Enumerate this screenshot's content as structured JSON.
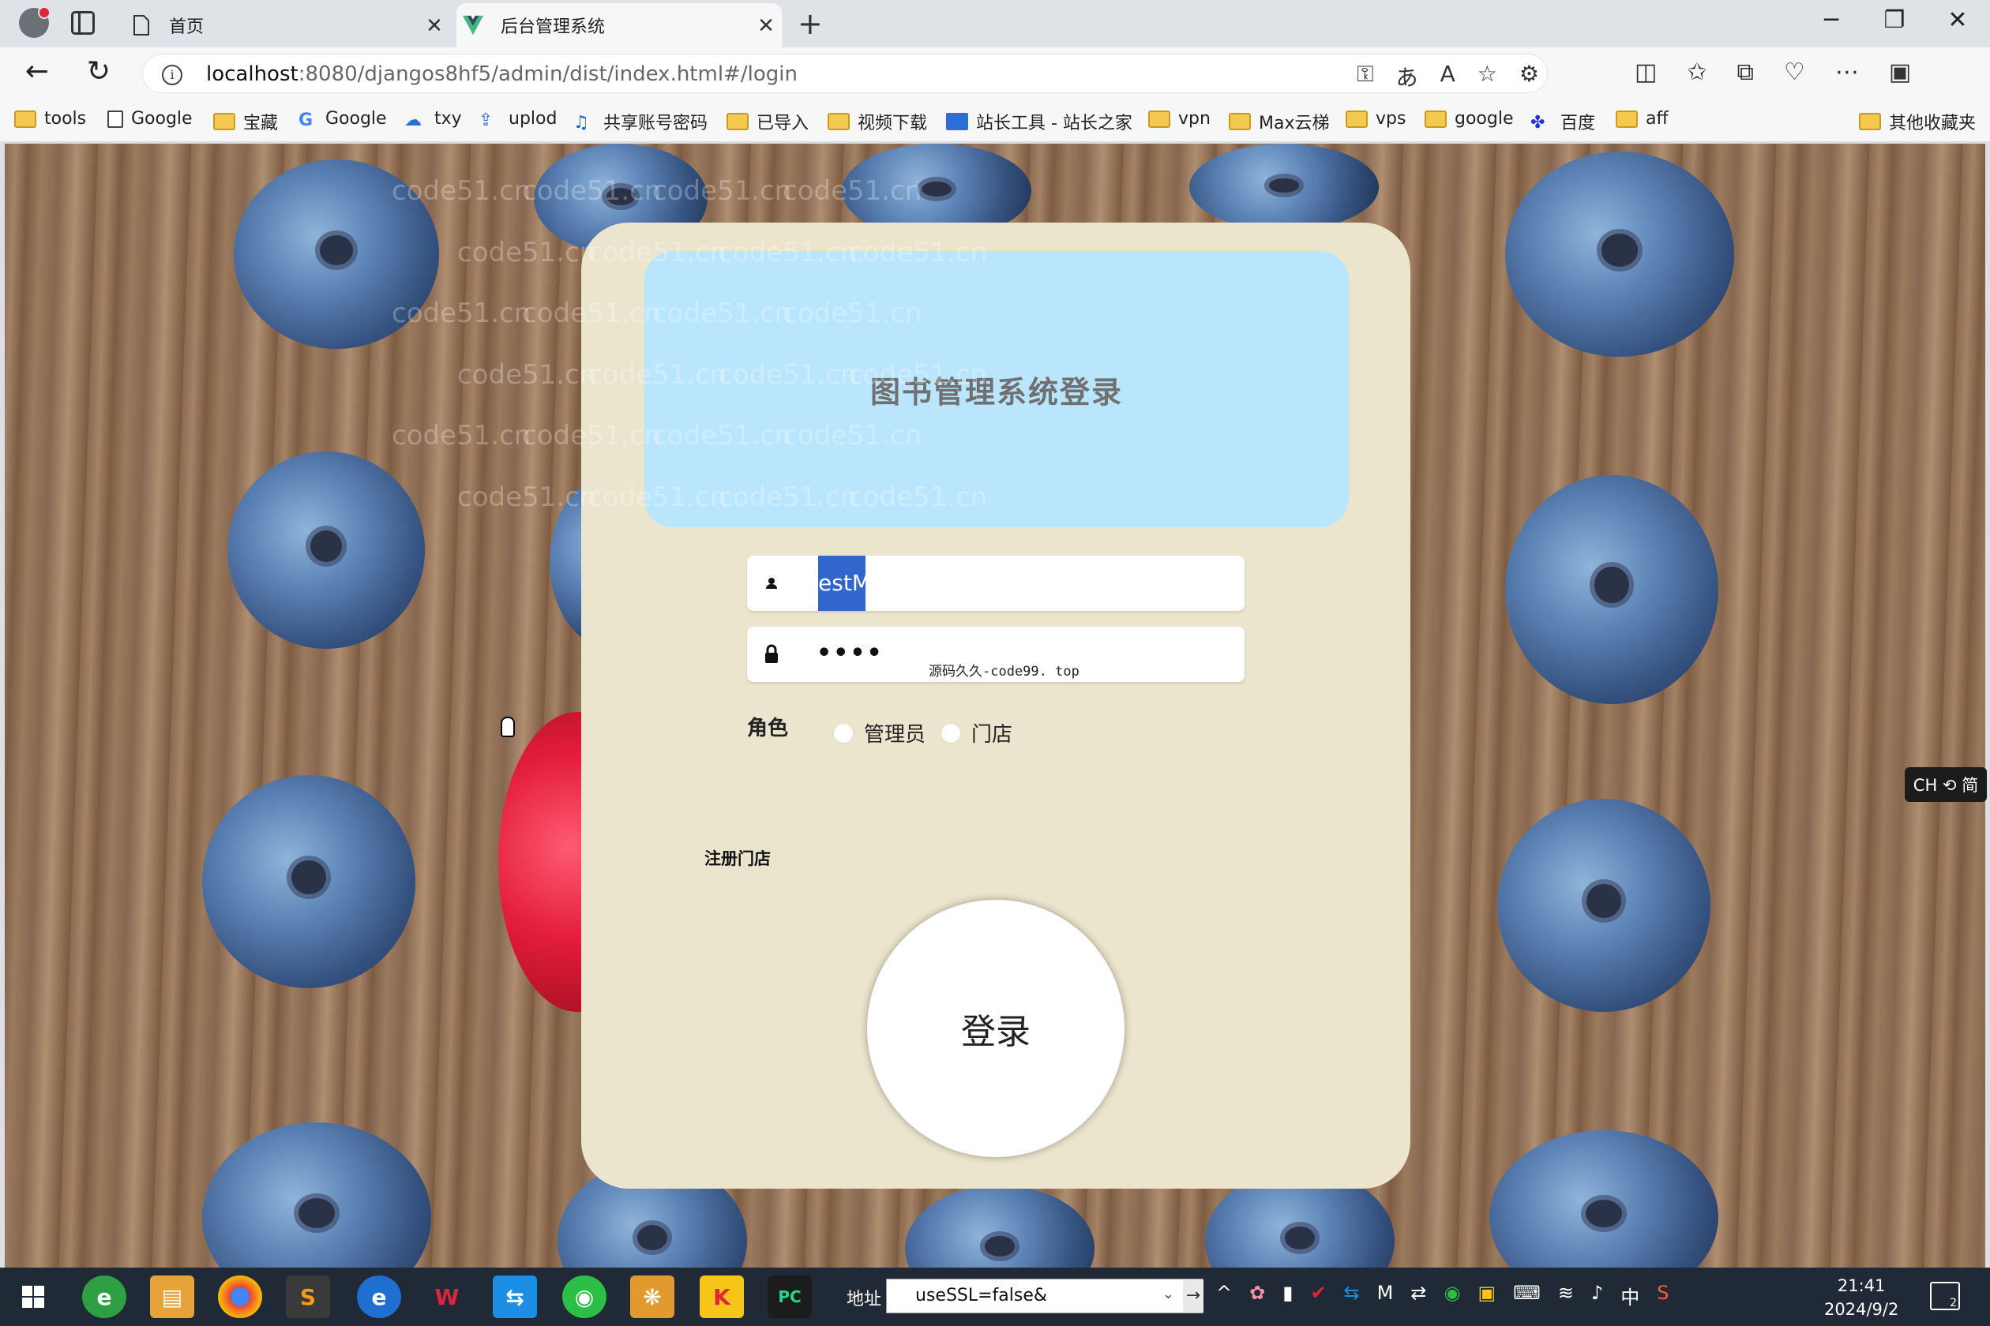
{
  "browser": {
    "tabs": [
      {
        "label": "首页"
      },
      {
        "label": "后台管理系统"
      }
    ],
    "url": {
      "host": "localhost",
      "rest": ":8080/djangos8hf5/admin/dist/index.html#/login"
    },
    "bookmarks": [
      {
        "label": "tools",
        "icon": "folder-icon"
      },
      {
        "label": "Google",
        "icon": "page-icon"
      },
      {
        "label": "宝藏",
        "icon": "folder-icon"
      },
      {
        "label": "Google",
        "icon": "google-icon"
      },
      {
        "label": "txy",
        "icon": "cloud-icon"
      },
      {
        "label": "uplod",
        "icon": "upload-icon"
      },
      {
        "label": "共享账号密码",
        "icon": "share-icon"
      },
      {
        "label": "已导入",
        "icon": "folder-icon"
      },
      {
        "label": "视频下载",
        "icon": "folder-icon"
      },
      {
        "label": "站长工具 - 站长之家",
        "icon": "chart-icon"
      },
      {
        "label": "vpn",
        "icon": "folder-icon"
      },
      {
        "label": "Max云梯",
        "icon": "folder-icon"
      },
      {
        "label": "vps",
        "icon": "folder-icon"
      },
      {
        "label": "google",
        "icon": "folder-icon"
      },
      {
        "label": "百度",
        "icon": "baidu-icon"
      },
      {
        "label": "aff",
        "icon": "folder-icon"
      },
      {
        "label": "其他收藏夹",
        "icon": "folder-icon"
      }
    ]
  },
  "login": {
    "title": "图书管理系统登录",
    "username_value": "estM",
    "password_mask": "••••",
    "password_note": "源码久久-code99. top",
    "role_label": "角色",
    "roles": [
      "管理员",
      "门店"
    ],
    "register_link": "注册门店",
    "submit_label": "登录"
  },
  "watermark": "code51.cn",
  "ime": "CH ⟲ 简",
  "taskbar": {
    "address_label": "地址",
    "address_value": "useSSL=false&",
    "time": "21:41",
    "date": "2024/9/2",
    "notification_count": "2",
    "ime_indicator": "中"
  },
  "colors": {
    "card": "#ece5cd",
    "banner": "#bae6fd",
    "selection": "#3366cc"
  }
}
